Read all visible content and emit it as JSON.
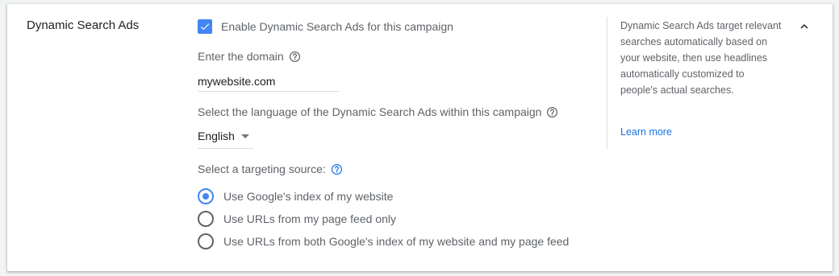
{
  "section": {
    "title": "Dynamic Search Ads"
  },
  "enable": {
    "label": "Enable Dynamic Search Ads for this campaign",
    "checked": true
  },
  "domain": {
    "label": "Enter the domain",
    "value": "mywebsite.com"
  },
  "language": {
    "label": "Select the language of the Dynamic Search Ads within this campaign",
    "selected": "English"
  },
  "targeting": {
    "label": "Select a targeting source:",
    "options": [
      {
        "label": "Use Google's index of my website",
        "checked": true
      },
      {
        "label": "Use URLs from my page feed only",
        "checked": false
      },
      {
        "label": "Use URLs from both Google's index of my website and my page feed",
        "checked": false
      }
    ]
  },
  "sidebar": {
    "description": "Dynamic Search Ads target relevant searches automatically based on your website, then use headlines automatically customized to people's actual searches.",
    "link_label": "Learn more"
  },
  "icons": {
    "help": "help-circle-icon",
    "collapse": "chevron-up-icon",
    "check": "check-icon"
  },
  "colors": {
    "accent": "#4285f4",
    "link": "#1a73e8",
    "text_primary": "#202124",
    "text_secondary": "#5f6368"
  }
}
